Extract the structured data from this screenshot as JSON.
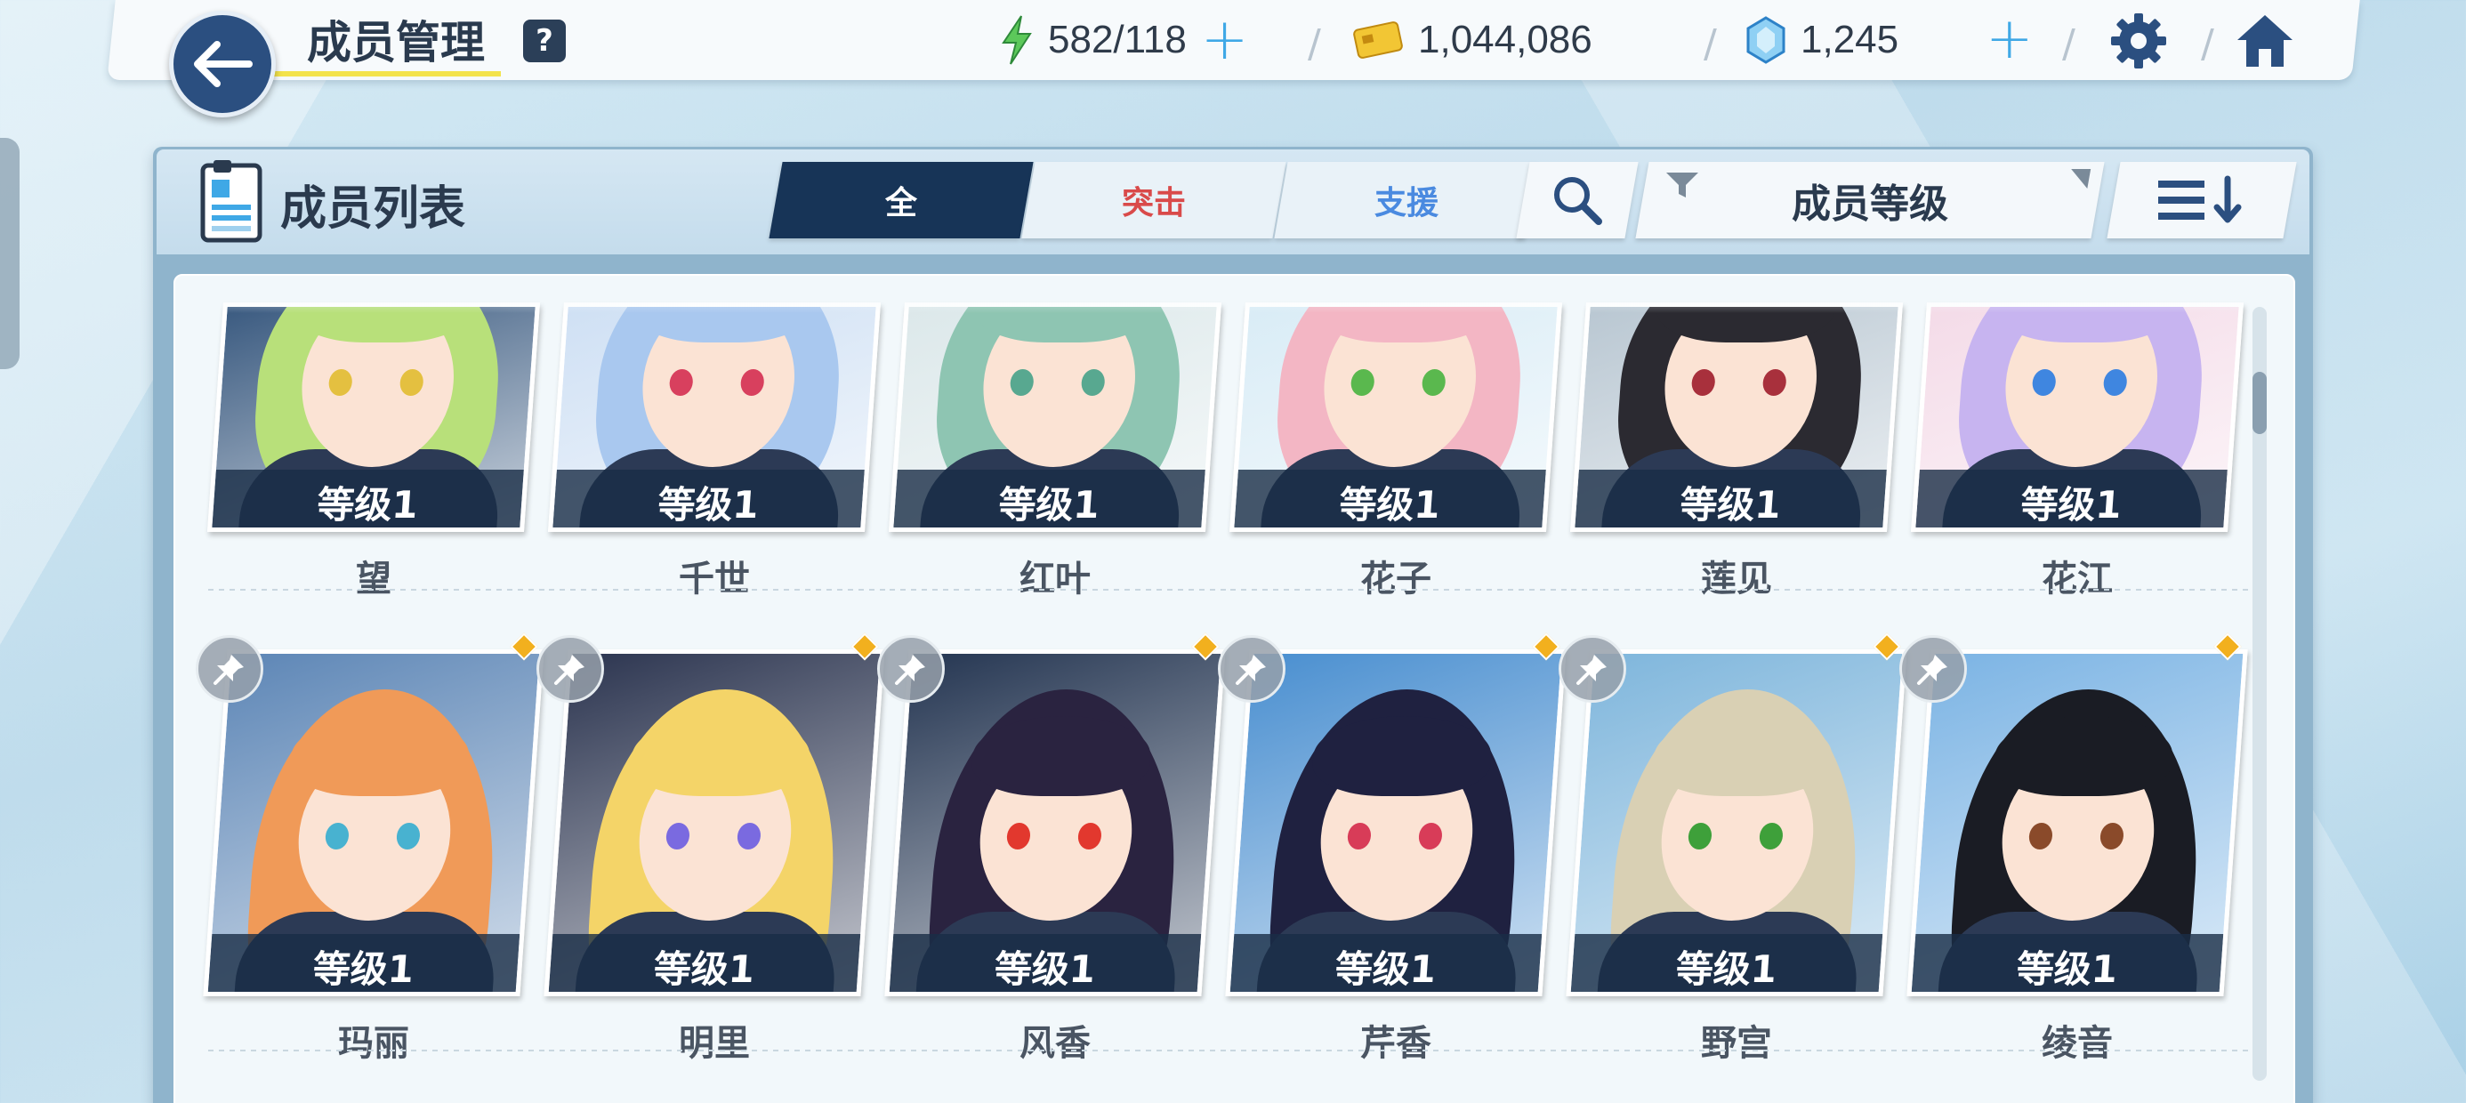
{
  "header": {
    "title": "成员管理",
    "help_label": "?",
    "resources": [
      {
        "icon": "lightning-icon",
        "value": "582/118"
      },
      {
        "icon": "credit-card-icon",
        "value": "1,044,086"
      },
      {
        "icon": "gem-icon",
        "value": "1,245"
      }
    ],
    "colors": {
      "accent": "#3fa8e6",
      "nav_dark": "#2b4f80",
      "underline": "#f3e34b"
    }
  },
  "list": {
    "title": "成员列表",
    "tabs": [
      {
        "label": "全",
        "active": true
      },
      {
        "label": "突击",
        "active": false
      },
      {
        "label": "支援",
        "active": false
      }
    ],
    "sort_label": "成员等级"
  },
  "members_row1": [
    {
      "name": "望",
      "level": "等级1",
      "hair": "#b8e07a",
      "bg": "#3a5a80",
      "eye": "#e4c040"
    },
    {
      "name": "千世",
      "level": "等级1",
      "hair": "#a9c8ef",
      "bg": "#cfe0f4",
      "eye": "#d8405e"
    },
    {
      "name": "红叶",
      "level": "等级1",
      "hair": "#8ec5b2",
      "bg": "#dce8ea",
      "eye": "#58a890"
    },
    {
      "name": "花子",
      "level": "等级1",
      "hair": "#f3b6c4",
      "bg": "#d9ecf6",
      "eye": "#5ab84e"
    },
    {
      "name": "莲见",
      "level": "等级1",
      "hair": "#2b2a31",
      "bg": "#b9c7d2",
      "eye": "#a8303c"
    },
    {
      "name": "花江",
      "level": "等级1",
      "hair": "#c7b4f0",
      "bg": "#f4dbe8",
      "eye": "#3f86e0"
    }
  ],
  "members_row2": [
    {
      "name": "玛丽",
      "level": "等级1",
      "hair": "#f09a58",
      "bg": "#5d86b6",
      "eye": "#48b2d0"
    },
    {
      "name": "明里",
      "level": "等级1",
      "hair": "#f4d468",
      "bg": "#2c3550",
      "eye": "#7a6ae0"
    },
    {
      "name": "风香",
      "level": "等级1",
      "hair": "#2a2340",
      "bg": "#253652",
      "eye": "#e2382e"
    },
    {
      "name": "芹香",
      "level": "等级1",
      "hair": "#1f2140",
      "bg": "#4a8fd0",
      "eye": "#d83c58"
    },
    {
      "name": "野宫",
      "level": "等级1",
      "hair": "#d9d0b4",
      "bg": "#7fb6dc",
      "eye": "#3ea03a"
    },
    {
      "name": "绫音",
      "level": "等级1",
      "hair": "#1a1c24",
      "bg": "#7cb4e4",
      "eye": "#8a4a2a"
    }
  ]
}
